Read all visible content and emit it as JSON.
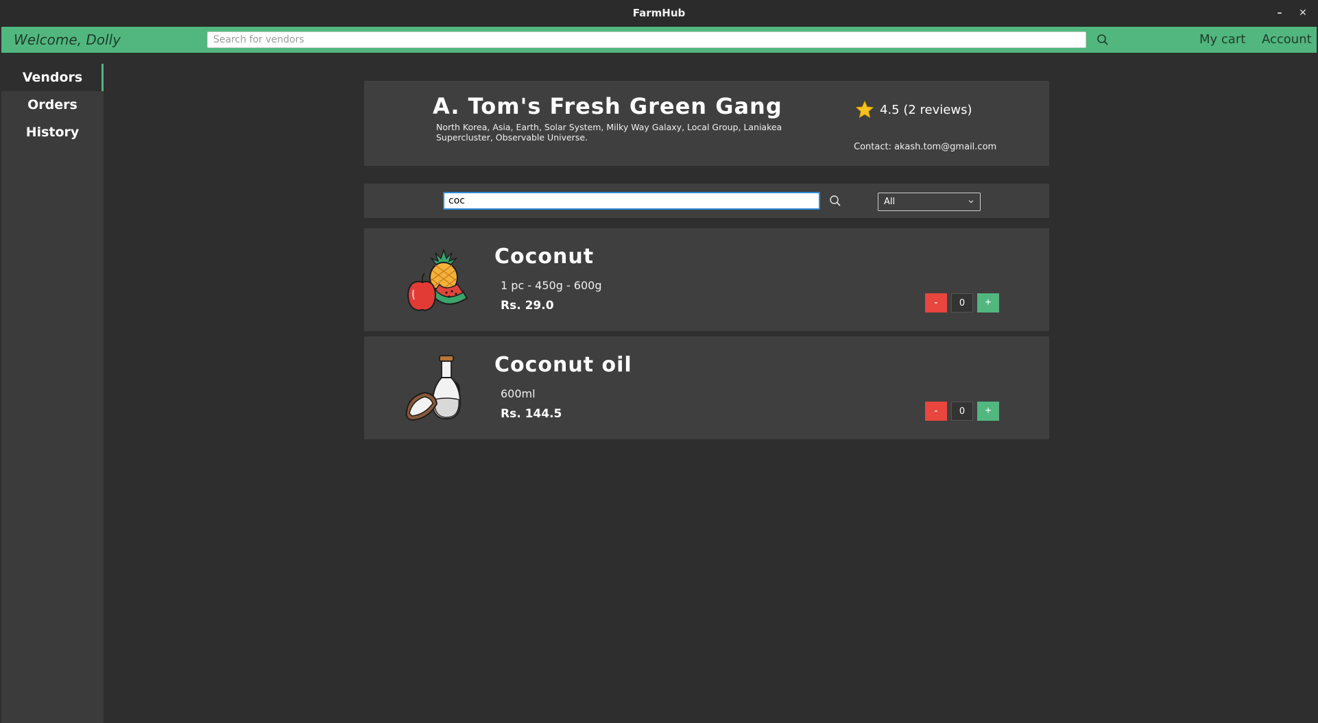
{
  "window": {
    "title": "FarmHub",
    "minimize_glyph": "–",
    "close_glyph": "✕"
  },
  "topbar": {
    "welcome": "Welcome, Dolly",
    "search_placeholder": "Search for vendors",
    "cart_label": "My cart",
    "account_label": "Account",
    "accent_color": "#51b77e"
  },
  "sidebar": {
    "items": [
      {
        "label": "Vendors",
        "active": true
      },
      {
        "label": "Orders",
        "active": false
      },
      {
        "label": "History",
        "active": false
      }
    ]
  },
  "vendor": {
    "name": "A. Tom's Fresh Green Gang",
    "address": "North Korea, Asia, Earth, Solar System, Milky Way Galaxy, Local Group, Laniakea Supercluster, Observable Universe.",
    "rating_text": "4.5 (2 reviews)",
    "contact": "Contact: akash.tom@gmail.com"
  },
  "filter": {
    "search_value": "coc",
    "category_selected": "All"
  },
  "products": [
    {
      "name": "Coconut",
      "size": "1 pc - 450g - 600g",
      "price": "Rs. 29.0",
      "quantity": "0",
      "icon": "fruits-icon"
    },
    {
      "name": "Coconut oil",
      "size": "600ml",
      "price": "Rs. 144.5",
      "quantity": "0",
      "icon": "oil-bottle-icon"
    }
  ],
  "controls": {
    "minus_label": "-",
    "plus_label": "+"
  }
}
